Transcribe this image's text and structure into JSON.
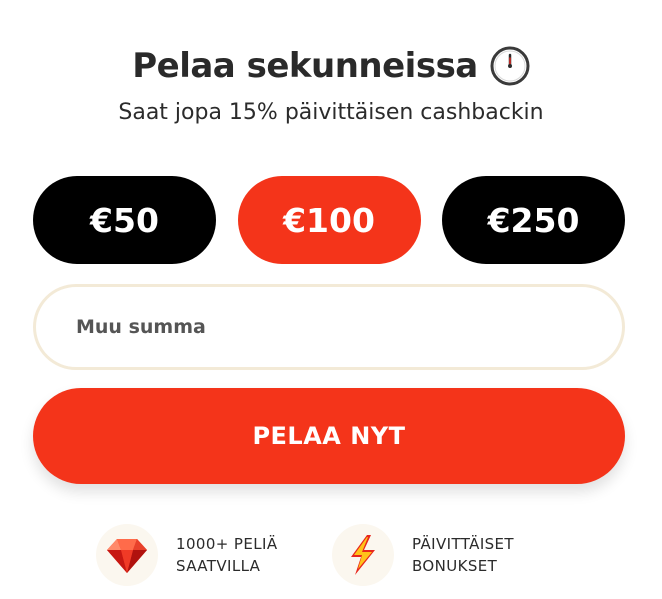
{
  "header": {
    "title": "Pelaa sekunneissa",
    "subtitle": "Saat jopa 15% päivittäisen cashbackin",
    "title_icon": "clock-icon"
  },
  "amounts": [
    {
      "label": "€50",
      "selected": false
    },
    {
      "label": "€100",
      "selected": true
    },
    {
      "label": "€250",
      "selected": false
    }
  ],
  "custom_amount": {
    "placeholder": "Muu summa",
    "value": ""
  },
  "cta": {
    "label": "PELAA NYT"
  },
  "features": [
    {
      "icon": "gem-icon",
      "line1": "1000+ PELIÄ",
      "line2": "SAATVILLA"
    },
    {
      "icon": "lightning-icon",
      "line1": "PÄIVITTÄISET",
      "line2": "BONUKSET"
    }
  ],
  "colors": {
    "accent": "#f4341a",
    "dark_button": "#000000",
    "field_border": "#f3ead7"
  }
}
